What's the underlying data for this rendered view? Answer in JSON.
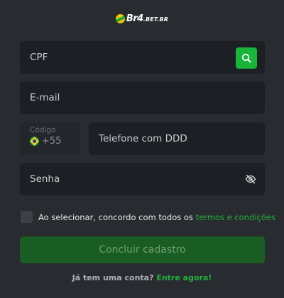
{
  "logo": {
    "brand": "Br4",
    "tld": ".BET.BR",
    "icon": "ball-logo-icon"
  },
  "form": {
    "cpf_placeholder": "CPF",
    "search_icon": "search-icon",
    "email_placeholder": "E-mail",
    "code_label": "Código",
    "code_value": "+55",
    "flag_icon": "brazil-flag-icon",
    "phone_placeholder": "Telefone com DDD",
    "password_placeholder": "Senha",
    "password_icon": "eye-slash-icon"
  },
  "terms": {
    "text": "Ao selecionar, concordo com todos os",
    "link": "termos e condições"
  },
  "submit_label": "Concluir cadastro",
  "login": {
    "question": "Já tem uma conta?",
    "link": "Entre agora!"
  },
  "colors": {
    "background": "#282c31",
    "field": "#1c2024",
    "accent": "#23b13c",
    "button": "#1a5d22"
  }
}
